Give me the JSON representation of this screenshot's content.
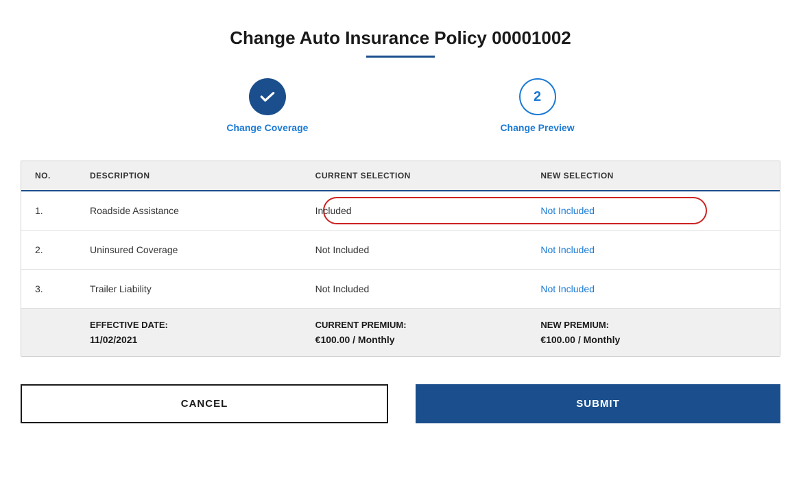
{
  "header": {
    "title": "Change Auto Insurance Policy 00001002"
  },
  "stepper": {
    "step1": {
      "label": "Change Coverage",
      "state": "completed"
    },
    "step2": {
      "number": "2",
      "label": "Change Preview",
      "state": "active"
    }
  },
  "table": {
    "columns": {
      "no": "NO.",
      "description": "DESCRIPTION",
      "current_selection": "CURRENT SELECTION",
      "new_selection": "NEW SELECTION"
    },
    "rows": [
      {
        "no": "1.",
        "description": "Roadside Assistance",
        "current_selection": "Included",
        "new_selection": "Not Included",
        "highlighted": true
      },
      {
        "no": "2.",
        "description": "Uninsured Coverage",
        "current_selection": "Not Included",
        "new_selection": "Not Included",
        "highlighted": false
      },
      {
        "no": "3.",
        "description": "Trailer Liability",
        "current_selection": "Not Included",
        "new_selection": "Not Included",
        "highlighted": false
      }
    ],
    "footer": {
      "effective_date_label": "EFFECTIVE DATE:",
      "effective_date_value": "11/02/2021",
      "current_premium_label": "CURRENT PREMIUM:",
      "current_premium_value": "€100.00 / Monthly",
      "new_premium_label": "NEW PREMIUM:",
      "new_premium_value": "€100.00 / Monthly"
    }
  },
  "buttons": {
    "cancel": "CANCEL",
    "submit": "SUBMIT"
  }
}
